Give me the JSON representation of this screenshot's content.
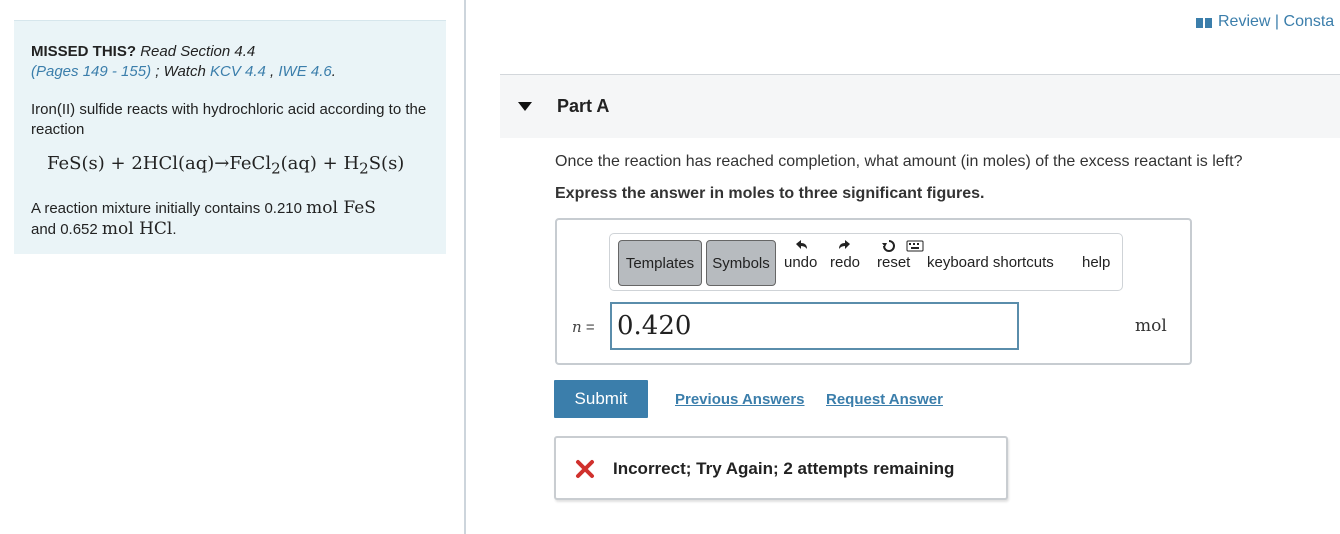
{
  "hint": {
    "missed_label": "MISSED THIS?",
    "read_text": "Read Section 4.4",
    "pages_link": "(Pages 149 - 155)",
    "watch_sep": " ; Watch ",
    "kcv_link": "KCV 4.4",
    "comma": " , ",
    "iwe_link": "IWE 4.6",
    "period": "."
  },
  "problem": {
    "intro": "Iron(II) sulfide reacts with hydrochloric acid according to the reaction",
    "reaction": {
      "reactant1": "FeS(s)",
      "plus1": " + ",
      "reactant2": "2HCl(aq)",
      "arrow": "→",
      "product1_a": "FeCl",
      "product1_sub": "2",
      "product1_b": "(aq)",
      "plus2": " + ",
      "product2_a": "H",
      "product2_sub": "2",
      "product2_b": "S(s)"
    },
    "mix_a": "A reaction mixture initially contains 0.210 ",
    "mix_unit1": "mol FeS",
    "mix_b": "and 0.652 ",
    "mix_unit2": "mol HCl",
    "mix_c": "."
  },
  "header": {
    "review_link": "Review | Consta"
  },
  "part": {
    "title": "Part A",
    "question": "Once the reaction has reached completion, what amount (in moles) of the excess reactant is left?",
    "instruction": "Express the answer in moles to three significant figures."
  },
  "toolbar": {
    "templates": "Templates",
    "symbols": "Symbols",
    "undo": "undo",
    "redo": "redo",
    "reset": "reset",
    "keyboard": "keyboard shortcuts",
    "help": "help"
  },
  "answer": {
    "var_label": "n",
    "equals": " =",
    "value": "0.420",
    "unit": "mol"
  },
  "actions": {
    "submit": "Submit",
    "previous": "Previous Answers",
    "request": "Request Answer"
  },
  "feedback": {
    "message": "Incorrect; Try Again; 2 attempts remaining",
    "color": "#d0312d"
  }
}
